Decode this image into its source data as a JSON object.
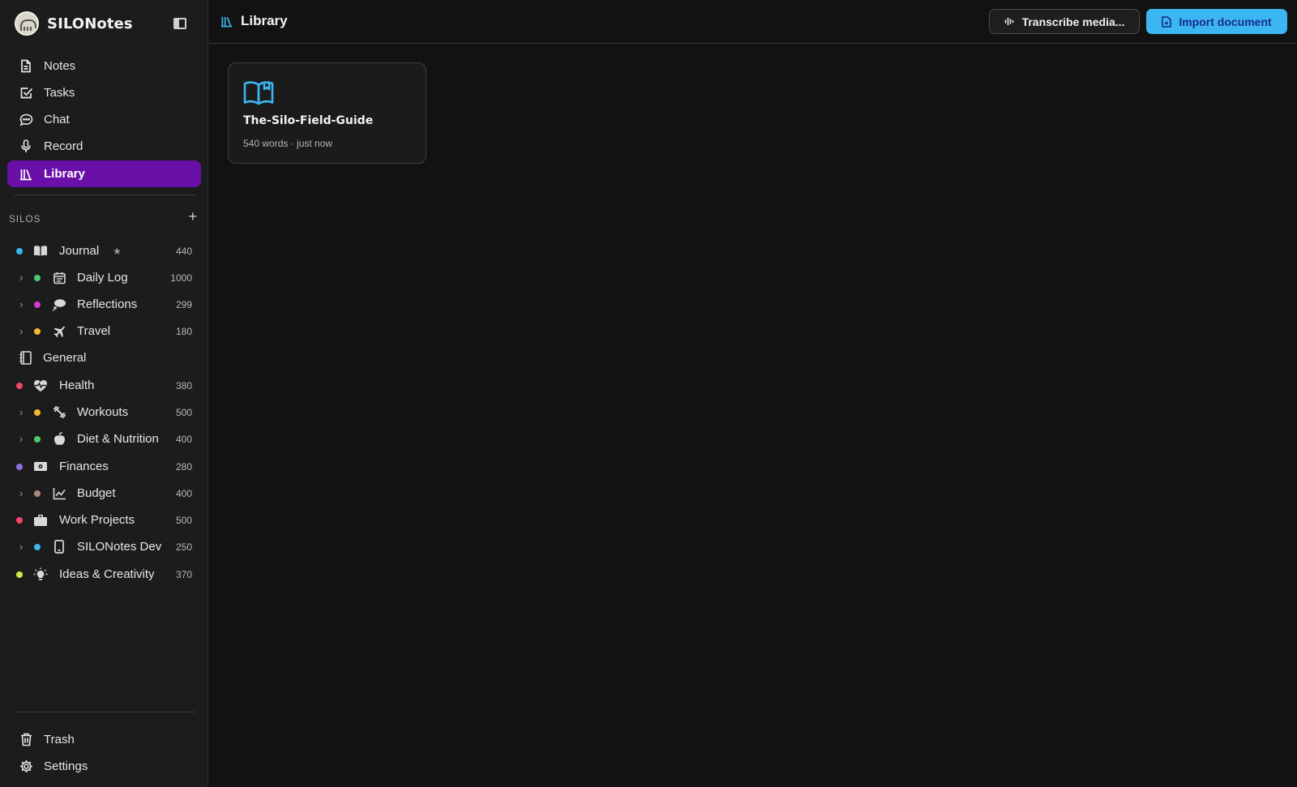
{
  "app": {
    "name": "SILONotes"
  },
  "nav": {
    "items": [
      {
        "label": "Notes",
        "icon": "file-text-icon"
      },
      {
        "label": "Tasks",
        "icon": "checkbox-icon"
      },
      {
        "label": "Chat",
        "icon": "chat-bubble-icon"
      },
      {
        "label": "Record",
        "icon": "microphone-icon"
      },
      {
        "label": "Library",
        "icon": "library-icon",
        "active": true
      }
    ]
  },
  "silos": {
    "label": "SILOS",
    "items": [
      {
        "name": "Journal",
        "count": "440",
        "dot": "#3cb6f3",
        "icon": "book-open-icon",
        "starred": true,
        "level": 0
      },
      {
        "name": "Daily Log",
        "count": "1000",
        "dot": "#4ecb71",
        "icon": "calendar-icon",
        "level": 1
      },
      {
        "name": "Reflections",
        "count": "299",
        "dot": "#d53ad1",
        "icon": "thought-bubble-icon",
        "level": 1
      },
      {
        "name": "Travel",
        "count": "180",
        "dot": "#f5b731",
        "icon": "airplane-icon",
        "level": 1
      },
      {
        "name": "General",
        "count": "",
        "dot": "",
        "icon": "notebook-icon",
        "level": 0
      },
      {
        "name": "Health",
        "count": "380",
        "dot": "#f0466c",
        "icon": "heart-pulse-icon",
        "level": 0
      },
      {
        "name": "Workouts",
        "count": "500",
        "dot": "#f5b731",
        "icon": "dumbbell-icon",
        "level": 1
      },
      {
        "name": "Diet & Nutrition",
        "count": "400",
        "dot": "#4ecb71",
        "icon": "apple-icon",
        "level": 1
      },
      {
        "name": "Finances",
        "count": "280",
        "dot": "#8c6fe0",
        "icon": "banknote-icon",
        "level": 0
      },
      {
        "name": "Budget",
        "count": "400",
        "dot": "#a88a7d",
        "icon": "line-chart-icon",
        "level": 1
      },
      {
        "name": "Work Projects",
        "count": "500",
        "dot": "#f0466c",
        "icon": "briefcase-icon",
        "level": 0
      },
      {
        "name": "SILONotes Dev",
        "count": "250",
        "dot": "#3cb6f3",
        "icon": "smartphone-icon",
        "level": 1
      },
      {
        "name": "Ideas & Creativity",
        "count": "370",
        "dot": "#cde84a",
        "icon": "lightbulb-icon",
        "level": 0
      }
    ]
  },
  "footer_nav": {
    "trash": "Trash",
    "settings": "Settings"
  },
  "header": {
    "title": "Library",
    "transcribe_label": "Transcribe media...",
    "import_label": "Import document"
  },
  "documents": [
    {
      "title": "The-Silo-Field-Guide",
      "meta": "540 words · just now"
    }
  ],
  "colors": {
    "accent_active": "#6a0fa8",
    "primary_button": "#3cb6f3",
    "icon_blue": "#3cb6f3"
  }
}
